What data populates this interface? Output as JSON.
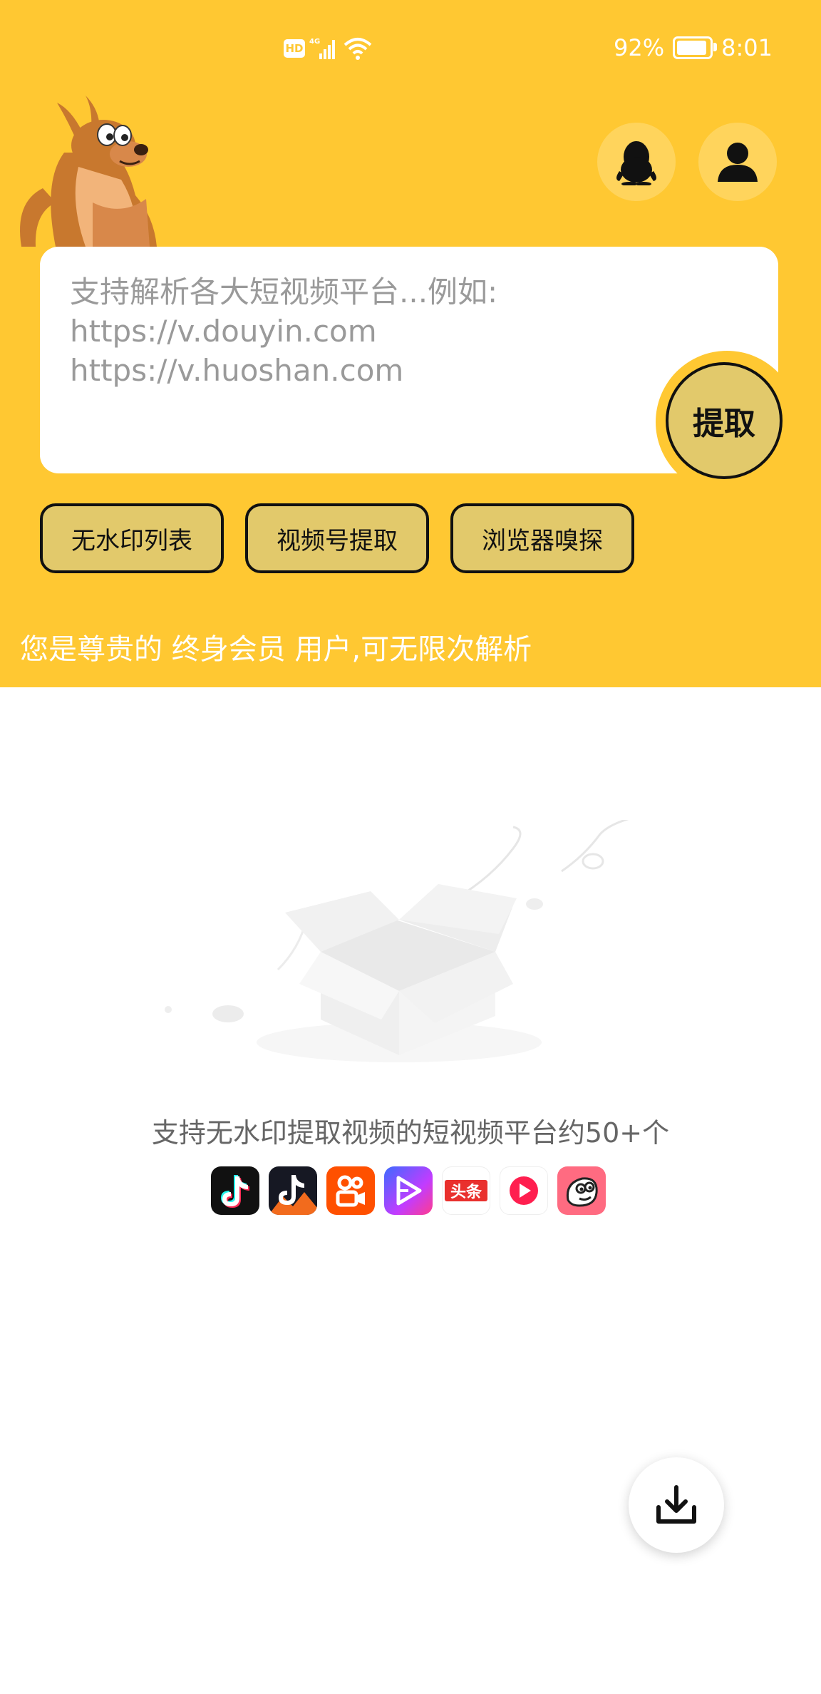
{
  "status_bar": {
    "hd": "HD",
    "network": "4G",
    "battery_text": "92%",
    "battery_level": 0.92,
    "time": "8:01"
  },
  "header": {
    "qq_icon": "qq-penguin-icon",
    "user_icon": "user-icon"
  },
  "search": {
    "placeholder": "支持解析各大短视频平台...例如:\nhttps://v.douyin.com\nhttps://v.huoshan.com",
    "extract_label": "提取"
  },
  "tools": [
    {
      "label": "无水印列表"
    },
    {
      "label": "视频号提取"
    },
    {
      "label": "浏览器嗅探"
    }
  ],
  "member_text": "您是尊贵的 终身会员 用户,可无限次解析",
  "empty_state": {
    "caption": "支持无水印提取视频的短视频平台约50+个",
    "platforms": [
      "tiktok-icon",
      "douyin-icon",
      "kuaishou-icon",
      "weishi-icon",
      "toutiao-icon",
      "xigua-icon",
      "pipixia-icon"
    ],
    "toutiao_text": "头条"
  },
  "fab": {
    "icon": "download-icon"
  },
  "colors": {
    "brand_yellow": "#FFC832",
    "button_fill": "#E2C96B",
    "outline": "#111111"
  }
}
